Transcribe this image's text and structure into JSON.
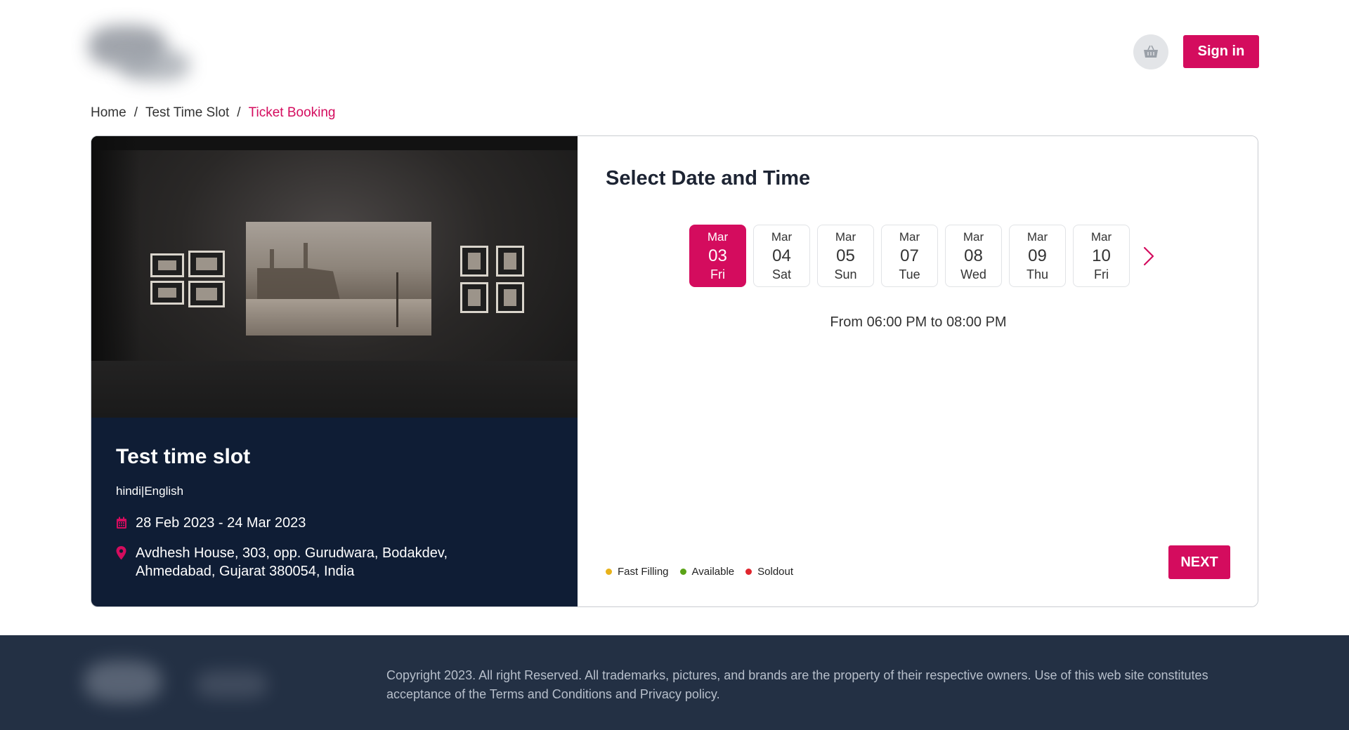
{
  "header": {
    "signin_label": "Sign in",
    "cart_icon": "basket-icon"
  },
  "breadcrumb": {
    "items": [
      "Home",
      "Test Time Slot",
      "Ticket Booking"
    ],
    "separator": "/"
  },
  "event": {
    "title": "Test time slot",
    "languages": "hindi|English",
    "date_range": "28 Feb 2023 - 24 Mar 2023",
    "address": "Avdhesh House, 303, opp. Gurudwara, Bodakdev, Ahmedabad, Gujarat 380054, India",
    "calendar_icon": "calendar-icon",
    "location_icon": "location-pin-icon"
  },
  "booking": {
    "heading": "Select Date and Time",
    "dates": [
      {
        "month": "Mar",
        "day": "03",
        "weekday": "Fri",
        "selected": true
      },
      {
        "month": "Mar",
        "day": "04",
        "weekday": "Sat",
        "selected": false
      },
      {
        "month": "Mar",
        "day": "05",
        "weekday": "Sun",
        "selected": false
      },
      {
        "month": "Mar",
        "day": "07",
        "weekday": "Tue",
        "selected": false
      },
      {
        "month": "Mar",
        "day": "08",
        "weekday": "Wed",
        "selected": false
      },
      {
        "month": "Mar",
        "day": "09",
        "weekday": "Thu",
        "selected": false
      },
      {
        "month": "Mar",
        "day": "10",
        "weekday": "Fri",
        "selected": false
      }
    ],
    "time_range": "From 06:00 PM to 08:00 PM",
    "legend": [
      {
        "label": "Fast Filling",
        "color": "#e8b21a"
      },
      {
        "label": "Available",
        "color": "#5aa317"
      },
      {
        "label": "Soldout",
        "color": "#e0262e"
      }
    ],
    "next_label": "NEXT"
  },
  "footer": {
    "copyright": "Copyright 2023. All right Reserved. All trademarks, pictures, and brands are the property of their respective owners. Use of this web site constitutes acceptance of the Terms and Conditions and Privacy policy."
  },
  "colors": {
    "accent": "#d40c5e",
    "event_panel_bg": "#0f1d35",
    "footer_bg": "#233044"
  }
}
